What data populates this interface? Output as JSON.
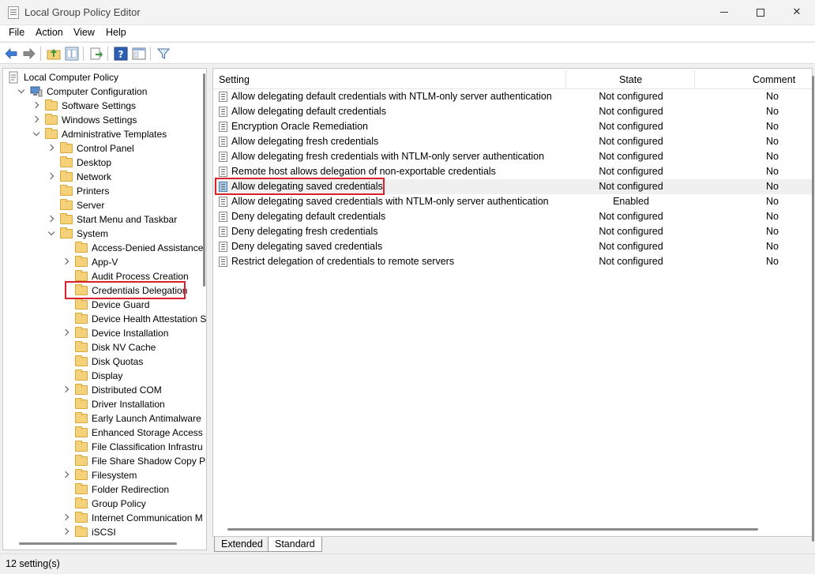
{
  "window": {
    "title": "Local Group Policy Editor"
  },
  "menu": [
    "File",
    "Action",
    "View",
    "Help"
  ],
  "tree": [
    {
      "label": "Local Computer Policy",
      "indent": 0,
      "expander": "none",
      "icon": "policy-icon"
    },
    {
      "label": "Computer Configuration",
      "indent": 1,
      "expander": "down",
      "icon": "computer-icon"
    },
    {
      "label": "Software Settings",
      "indent": 2,
      "expander": "right",
      "icon": "folder-icon"
    },
    {
      "label": "Windows Settings",
      "indent": 2,
      "expander": "right",
      "icon": "folder-icon"
    },
    {
      "label": "Administrative Templates",
      "indent": 2,
      "expander": "down",
      "icon": "folder-icon"
    },
    {
      "label": "Control Panel",
      "indent": 3,
      "expander": "right",
      "icon": "folder-icon"
    },
    {
      "label": "Desktop",
      "indent": 3,
      "expander": "none",
      "icon": "folder-icon"
    },
    {
      "label": "Network",
      "indent": 3,
      "expander": "right",
      "icon": "folder-icon"
    },
    {
      "label": "Printers",
      "indent": 3,
      "expander": "none",
      "icon": "folder-icon"
    },
    {
      "label": "Server",
      "indent": 3,
      "expander": "none",
      "icon": "folder-icon"
    },
    {
      "label": "Start Menu and Taskbar",
      "indent": 3,
      "expander": "right",
      "icon": "folder-icon"
    },
    {
      "label": "System",
      "indent": 3,
      "expander": "down",
      "icon": "folder-icon"
    },
    {
      "label": "Access-Denied Assistance",
      "indent": 4,
      "expander": "none",
      "icon": "folder-icon"
    },
    {
      "label": "App-V",
      "indent": 4,
      "expander": "right",
      "icon": "folder-icon"
    },
    {
      "label": "Audit Process Creation",
      "indent": 4,
      "expander": "none",
      "icon": "folder-icon"
    },
    {
      "label": "Credentials Delegation",
      "indent": 4,
      "expander": "none",
      "icon": "folder-icon",
      "selected": true
    },
    {
      "label": "Device Guard",
      "indent": 4,
      "expander": "none",
      "icon": "folder-icon"
    },
    {
      "label": "Device Health Attestation S",
      "indent": 4,
      "expander": "none",
      "icon": "folder-icon"
    },
    {
      "label": "Device Installation",
      "indent": 4,
      "expander": "right",
      "icon": "folder-icon"
    },
    {
      "label": "Disk NV Cache",
      "indent": 4,
      "expander": "none",
      "icon": "folder-icon"
    },
    {
      "label": "Disk Quotas",
      "indent": 4,
      "expander": "none",
      "icon": "folder-icon"
    },
    {
      "label": "Display",
      "indent": 4,
      "expander": "none",
      "icon": "folder-icon"
    },
    {
      "label": "Distributed COM",
      "indent": 4,
      "expander": "right",
      "icon": "folder-icon"
    },
    {
      "label": "Driver Installation",
      "indent": 4,
      "expander": "none",
      "icon": "folder-icon"
    },
    {
      "label": "Early Launch Antimalware",
      "indent": 4,
      "expander": "none",
      "icon": "folder-icon"
    },
    {
      "label": "Enhanced Storage Access",
      "indent": 4,
      "expander": "none",
      "icon": "folder-icon"
    },
    {
      "label": "File Classification Infrastru",
      "indent": 4,
      "expander": "none",
      "icon": "folder-icon"
    },
    {
      "label": "File Share Shadow Copy Pr",
      "indent": 4,
      "expander": "none",
      "icon": "folder-icon"
    },
    {
      "label": "Filesystem",
      "indent": 4,
      "expander": "right",
      "icon": "folder-icon"
    },
    {
      "label": "Folder Redirection",
      "indent": 4,
      "expander": "none",
      "icon": "folder-icon"
    },
    {
      "label": "Group Policy",
      "indent": 4,
      "expander": "none",
      "icon": "folder-icon"
    },
    {
      "label": "Internet Communication M",
      "indent": 4,
      "expander": "right",
      "icon": "folder-icon"
    },
    {
      "label": "iSCSI",
      "indent": 4,
      "expander": "right",
      "icon": "folder-icon"
    }
  ],
  "list": {
    "columns": {
      "setting": "Setting",
      "state": "State",
      "comment": "Comment"
    },
    "rows": [
      {
        "setting": "Allow delegating default credentials with NTLM-only server authentication",
        "state": "Not configured",
        "comment": "No"
      },
      {
        "setting": "Allow delegating default credentials",
        "state": "Not configured",
        "comment": "No"
      },
      {
        "setting": "Encryption Oracle Remediation",
        "state": "Not configured",
        "comment": "No"
      },
      {
        "setting": "Allow delegating fresh credentials",
        "state": "Not configured",
        "comment": "No"
      },
      {
        "setting": "Allow delegating fresh credentials with NTLM-only server authentication",
        "state": "Not configured",
        "comment": "No"
      },
      {
        "setting": "Remote host allows delegation of non-exportable credentials",
        "state": "Not configured",
        "comment": "No"
      },
      {
        "setting": "Allow delegating saved credentials",
        "state": "Not configured",
        "comment": "No",
        "selected": true
      },
      {
        "setting": "Allow delegating saved credentials with NTLM-only server authentication",
        "state": "Enabled",
        "comment": "No"
      },
      {
        "setting": "Deny delegating default credentials",
        "state": "Not configured",
        "comment": "No"
      },
      {
        "setting": "Deny delegating fresh credentials",
        "state": "Not configured",
        "comment": "No"
      },
      {
        "setting": "Deny delegating saved credentials",
        "state": "Not configured",
        "comment": "No"
      },
      {
        "setting": "Restrict delegation of credentials to remote servers",
        "state": "Not configured",
        "comment": "No"
      }
    ]
  },
  "tabs": [
    "Extended",
    "Standard"
  ],
  "status": {
    "text": "12 setting(s)"
  },
  "colors": {
    "highlight_box": "#d9202b",
    "folder": "#f5d27a",
    "selected_row": "#f0f0f0"
  }
}
